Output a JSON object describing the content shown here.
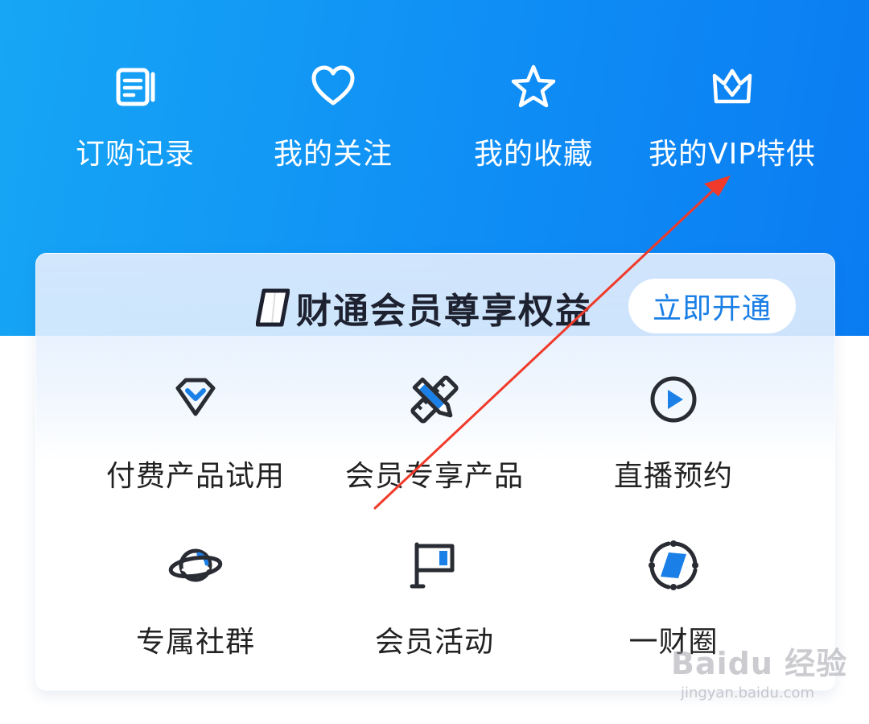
{
  "quick_links": [
    {
      "label": "订购记录",
      "icon": "order-record-icon"
    },
    {
      "label": "我的关注",
      "icon": "heart-icon"
    },
    {
      "label": "我的收藏",
      "icon": "star-icon"
    },
    {
      "label": "我的VIP特供",
      "icon": "crown-icon"
    }
  ],
  "member_card": {
    "title": "财通会员尊享权益",
    "open_button": "立即开通",
    "benefits": [
      {
        "label": "付费产品试用",
        "icon": "diamond-icon"
      },
      {
        "label": "会员专享产品",
        "icon": "pencil-ruler-icon"
      },
      {
        "label": "直播预约",
        "icon": "play-circle-icon"
      },
      {
        "label": "专属社群",
        "icon": "planet-icon"
      },
      {
        "label": "会员活动",
        "icon": "flag-icon"
      },
      {
        "label": "一财圈",
        "icon": "compass-icon"
      }
    ]
  },
  "annotation": {
    "type": "red-arrow",
    "color": "#f03a2a"
  },
  "watermark": {
    "logo": "Baidu 经验",
    "url": "jingyan.baidu.com"
  },
  "colors": {
    "brand_blue": "#0f8ef5",
    "button_text": "#1a7fe6",
    "arrow": "#f03a2a"
  }
}
